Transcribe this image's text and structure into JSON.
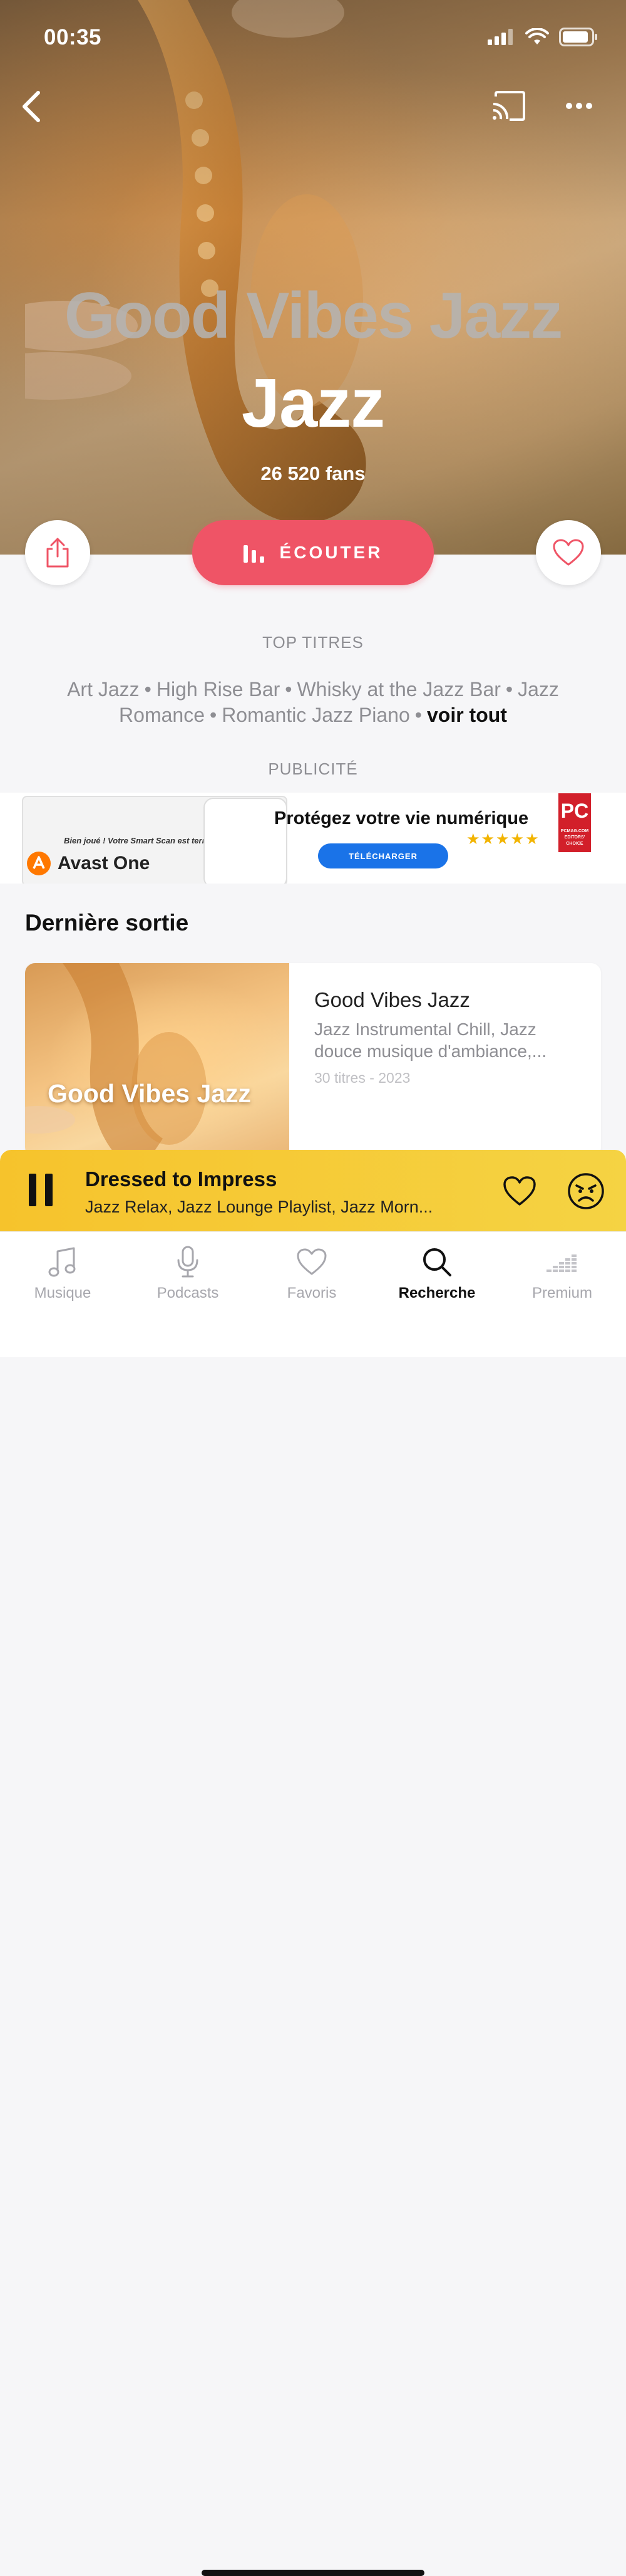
{
  "status_bar": {
    "time": "00:35"
  },
  "hero": {
    "cover_title": "Good Vibes Jazz",
    "genre_title": "Jazz",
    "fans": "26 520 fans"
  },
  "actions": {
    "listen_label": "ÉCOUTER"
  },
  "top_tracks": {
    "heading": "TOP TITRES",
    "items": [
      "Art Jazz",
      "High Rise Bar",
      "Whisky at the Jazz Bar",
      "Jazz Romance",
      "Romantic Jazz Piano"
    ],
    "see_all": "voir tout"
  },
  "ad": {
    "label": "PUBLICITÉ",
    "brand": "Avast One",
    "device_text": "Bien joué ! Votre Smart Scan est terminé.",
    "headline": "Protégez votre vie numérique",
    "cta": "TÉLÉCHARGER",
    "badge_text": "PC",
    "badge_sub": "PCMAG.COM EDITORS' CHOICE",
    "stars": "★★★★★"
  },
  "latest_release": {
    "heading": "Dernière sortie",
    "cover_text": "Good Vibes Jazz",
    "title": "Good Vibes Jazz",
    "description": "Jazz Instrumental Chill, Jazz douce musique d'ambiance,...",
    "meta": "30 titres - 2023"
  },
  "player": {
    "track": "Dressed to Impress",
    "artists": "Jazz Relax, Jazz Lounge Playlist, Jazz Morn..."
  },
  "tabs": [
    {
      "label": "Musique",
      "icon": "music-note-icon"
    },
    {
      "label": "Podcasts",
      "icon": "microphone-icon"
    },
    {
      "label": "Favoris",
      "icon": "heart-icon"
    },
    {
      "label": "Recherche",
      "icon": "search-icon",
      "active": true
    },
    {
      "label": "Premium",
      "icon": "equalizer-icon"
    }
  ],
  "colors": {
    "accent": "#ef5466",
    "player": "#f6c32c",
    "muted_text": "#8e8e93"
  }
}
